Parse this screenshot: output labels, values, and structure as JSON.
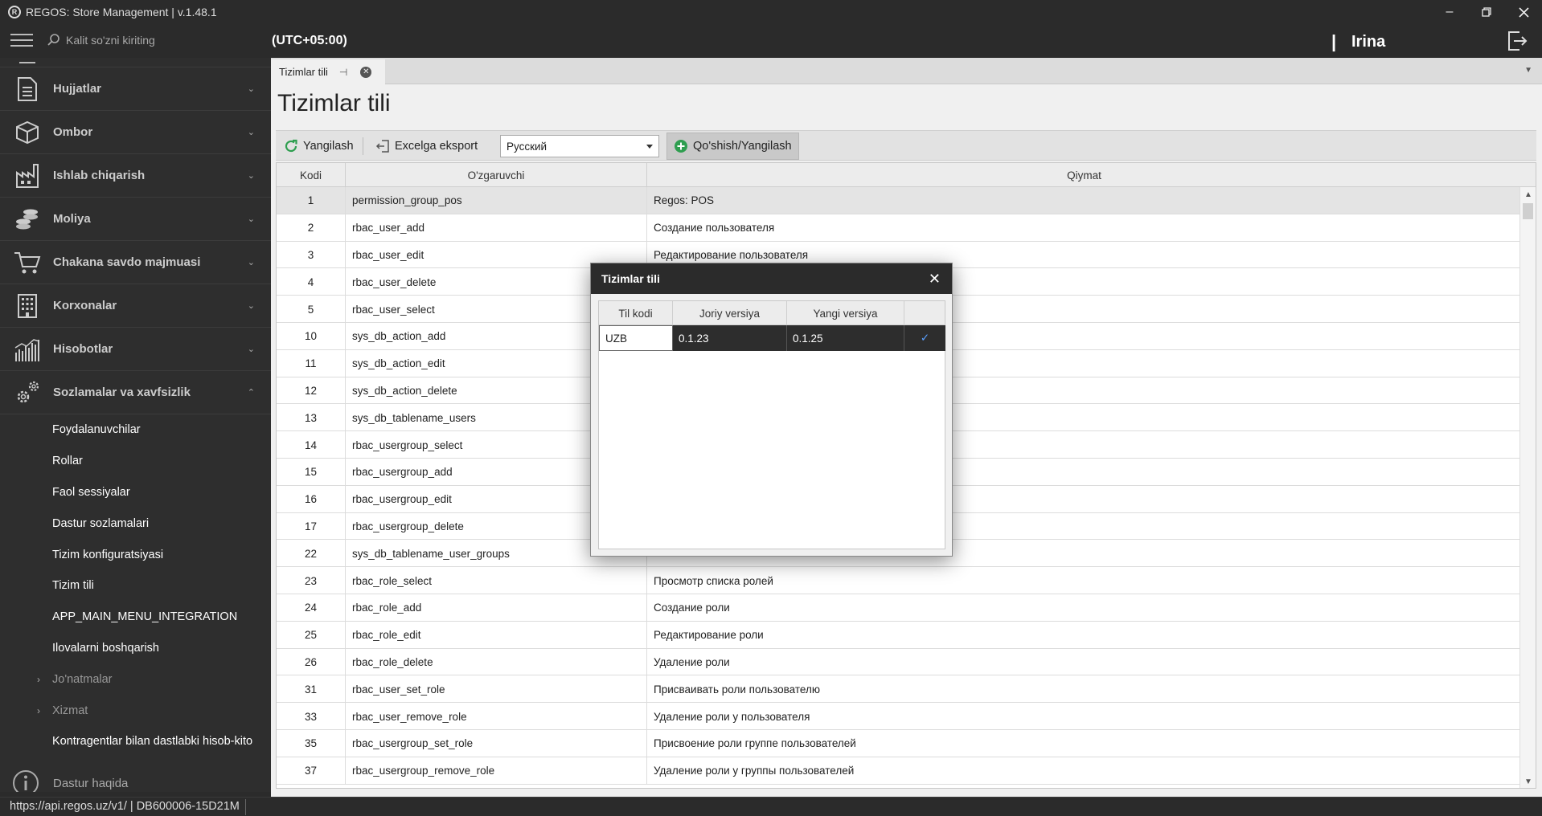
{
  "window": {
    "title": "REGOS: Store Management | v.1.48.1",
    "controls": [
      "minimize",
      "restore",
      "close"
    ]
  },
  "topbar": {
    "search_placeholder": "Kalit so'zni kiriting",
    "timezone": "(UTC+05:00)",
    "user_separator": "|",
    "username": "Irina"
  },
  "sidebar": {
    "sections": [
      {
        "label": "Hujjatlar",
        "icon": "document-icon",
        "expanded": false
      },
      {
        "label": "Ombor",
        "icon": "box-icon",
        "expanded": false
      },
      {
        "label": "Ishlab chiqarish",
        "icon": "factory-icon",
        "expanded": false
      },
      {
        "label": "Moliya",
        "icon": "coins-icon",
        "expanded": false
      },
      {
        "label": "Chakana savdo majmuasi",
        "icon": "cart-icon",
        "expanded": false
      },
      {
        "label": "Korxonalar",
        "icon": "building-icon",
        "expanded": false
      },
      {
        "label": "Hisobotlar",
        "icon": "chart-icon",
        "expanded": false
      },
      {
        "label": "Sozlamalar va xavfsizlik",
        "icon": "gears-icon",
        "expanded": true
      }
    ],
    "subitems": [
      {
        "label": "Foydalanuvchilar",
        "collapsible": false
      },
      {
        "label": "Rollar",
        "collapsible": false
      },
      {
        "label": "Faol sessiyalar",
        "collapsible": false
      },
      {
        "label": "Dastur sozlamalari",
        "collapsible": false
      },
      {
        "label": "Tizim konfiguratsiyasi",
        "collapsible": false
      },
      {
        "label": "Tizim tili",
        "collapsible": false
      },
      {
        "label": "APP_MAIN_MENU_INTEGRATION",
        "collapsible": false
      },
      {
        "label": "Ilovalarni boshqarish",
        "collapsible": false
      },
      {
        "label": "Jo'natmalar",
        "collapsible": true
      },
      {
        "label": "Xizmat",
        "collapsible": true
      },
      {
        "label": "Kontragentlar bilan dastlabki hisob-kito",
        "collapsible": false
      }
    ],
    "about_label": "Dastur haqida"
  },
  "tab": {
    "label": "Tizimlar tili",
    "pin_glyph": "⊣",
    "close_glyph": "✕"
  },
  "page": {
    "title": "Tizimlar tili"
  },
  "toolbar": {
    "refresh_label": "Yangilash",
    "export_label": "Excelga eksport",
    "language_selected": "Русский",
    "add_update_label": "Qo'shish/Yangilash"
  },
  "grid": {
    "columns": [
      "Kodi",
      "O'zgaruvchi",
      "Qiymat"
    ],
    "rows": [
      {
        "code": "1",
        "variable": "permission_group_pos",
        "value": "Regos: POS",
        "selected": true
      },
      {
        "code": "2",
        "variable": "rbac_user_add",
        "value": "Создание пользователя"
      },
      {
        "code": "3",
        "variable": "rbac_user_edit",
        "value": "Редактирование пользователя"
      },
      {
        "code": "4",
        "variable": "rbac_user_delete",
        "value": ""
      },
      {
        "code": "5",
        "variable": "rbac_user_select",
        "value": ""
      },
      {
        "code": "10",
        "variable": "sys_db_action_add",
        "value": ""
      },
      {
        "code": "11",
        "variable": "sys_db_action_edit",
        "value": ""
      },
      {
        "code": "12",
        "variable": "sys_db_action_delete",
        "value": ""
      },
      {
        "code": "13",
        "variable": "sys_db_tablename_users",
        "value": ""
      },
      {
        "code": "14",
        "variable": "rbac_usergroup_select",
        "value": ""
      },
      {
        "code": "15",
        "variable": "rbac_usergroup_add",
        "value": ""
      },
      {
        "code": "16",
        "variable": "rbac_usergroup_edit",
        "value": ""
      },
      {
        "code": "17",
        "variable": "rbac_usergroup_delete",
        "value": ""
      },
      {
        "code": "22",
        "variable": "sys_db_tablename_user_groups",
        "value": ""
      },
      {
        "code": "23",
        "variable": "rbac_role_select",
        "value": "Просмотр списка ролей"
      },
      {
        "code": "24",
        "variable": "rbac_role_add",
        "value": "Создание роли"
      },
      {
        "code": "25",
        "variable": "rbac_role_edit",
        "value": "Редактирование роли"
      },
      {
        "code": "26",
        "variable": "rbac_role_delete",
        "value": "Удаление роли"
      },
      {
        "code": "31",
        "variable": "rbac_user_set_role",
        "value": "Присваивать роли пользователю"
      },
      {
        "code": "33",
        "variable": "rbac_user_remove_role",
        "value": "Удаление роли у пользователя"
      },
      {
        "code": "35",
        "variable": "rbac_usergroup_set_role",
        "value": "Присвоение роли группе пользователей"
      },
      {
        "code": "37",
        "variable": "rbac_usergroup_remove_role",
        "value": "Удаление роли у группы пользователей"
      }
    ]
  },
  "dialog": {
    "title": "Tizimlar tili",
    "columns": [
      "Til kodi",
      "Joriy versiya",
      "Yangi versiya",
      ""
    ],
    "rows": [
      {
        "lang_code": "UZB",
        "current_version": "0.1.23",
        "new_version": "0.1.25",
        "checked": "✓"
      }
    ]
  },
  "statusbar": {
    "text": "https://api.regos.uz/v1/ | DB600006-15D21M"
  },
  "colors": {
    "dark_bg": "#2b2b2b",
    "sidebar_bg": "#2e2e2e",
    "content_bg": "#f0f0f0",
    "accent_green": "#2e9e4f",
    "check_blue": "#5aa0ff"
  }
}
